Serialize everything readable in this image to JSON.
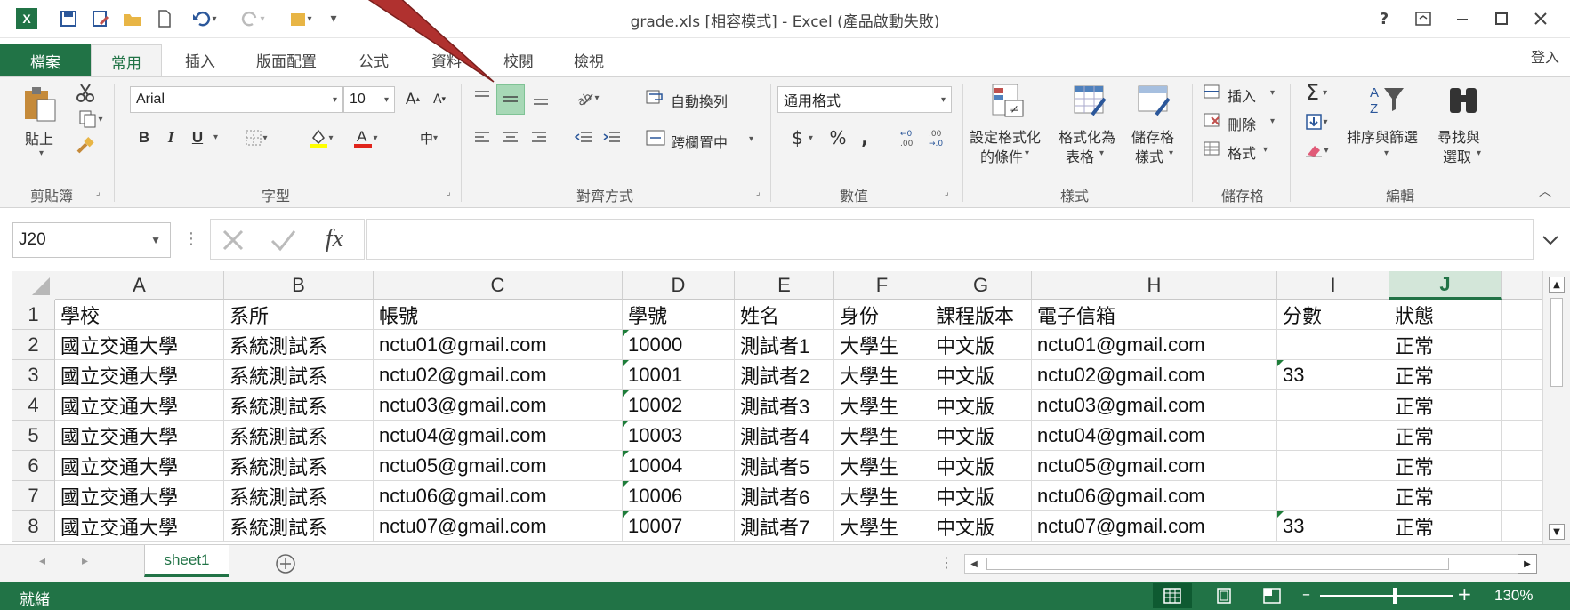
{
  "titlebar": {
    "title": "grade.xls  [相容模式] - Excel (產品啟動失敗)",
    "help": "?",
    "signin": "登入"
  },
  "tabs": {
    "file": "檔案",
    "home": "常用",
    "insert": "插入",
    "page_layout": "版面配置",
    "formulas": "公式",
    "data": "資料",
    "review": "校閱",
    "view": "檢視"
  },
  "ribbon": {
    "clipboard": {
      "paste": "貼上",
      "label": "剪貼簿"
    },
    "font": {
      "name": "Arial",
      "size": "10",
      "bold": "B",
      "italic": "I",
      "underline": "U",
      "label": "字型"
    },
    "alignment": {
      "wrap": "自動換列",
      "merge": "跨欄置中",
      "label": "對齊方式"
    },
    "number": {
      "format": "通用格式",
      "currency": "$",
      "percent": "%",
      "comma": ",",
      "label": "數值"
    },
    "styles": {
      "conditional": [
        "設定格式化",
        "的條件"
      ],
      "as_table": [
        "格式化為",
        "表格"
      ],
      "cell_styles": [
        "儲存格",
        "樣式"
      ],
      "label": "樣式"
    },
    "cells": {
      "insert": "插入",
      "delete": "刪除",
      "format": "格式",
      "label": "儲存格"
    },
    "editing": {
      "sort": "排序與篩選",
      "find": [
        "尋找與",
        "選取"
      ],
      "label": "編輯"
    }
  },
  "formula_bar": {
    "name_box": "J20",
    "fx": "fx",
    "value": ""
  },
  "grid": {
    "columns": [
      "A",
      "B",
      "C",
      "D",
      "E",
      "F",
      "G",
      "H",
      "I",
      "J"
    ],
    "rows": [
      "1",
      "2",
      "3",
      "4",
      "5",
      "6",
      "7",
      "8"
    ],
    "cells": [
      [
        "學校",
        "系所",
        "帳號",
        "學號",
        "姓名",
        "身份",
        "課程版本",
        "電子信箱",
        "分數",
        "狀態"
      ],
      [
        "國立交通大學",
        "系統測試系",
        "nctu01@gmail.com",
        "10000",
        "測試者1",
        "大學生",
        "中文版",
        "nctu01@gmail.com",
        "",
        "正常"
      ],
      [
        "國立交通大學",
        "系統測試系",
        "nctu02@gmail.com",
        "10001",
        "測試者2",
        "大學生",
        "中文版",
        "nctu02@gmail.com",
        "33",
        "正常"
      ],
      [
        "國立交通大學",
        "系統測試系",
        "nctu03@gmail.com",
        "10002",
        "測試者3",
        "大學生",
        "中文版",
        "nctu03@gmail.com",
        "",
        "正常"
      ],
      [
        "國立交通大學",
        "系統測試系",
        "nctu04@gmail.com",
        "10003",
        "測試者4",
        "大學生",
        "中文版",
        "nctu04@gmail.com",
        "",
        "正常"
      ],
      [
        "國立交通大學",
        "系統測試系",
        "nctu05@gmail.com",
        "10004",
        "測試者5",
        "大學生",
        "中文版",
        "nctu05@gmail.com",
        "",
        "正常"
      ],
      [
        "國立交通大學",
        "系統測試系",
        "nctu06@gmail.com",
        "10006",
        "測試者6",
        "大學生",
        "中文版",
        "nctu06@gmail.com",
        "",
        "正常"
      ],
      [
        "國立交通大學",
        "系統測試系",
        "nctu07@gmail.com",
        "10007",
        "測試者7",
        "大學生",
        "中文版",
        "nctu07@gmail.com",
        "33",
        "正常"
      ]
    ],
    "selected_column": "J"
  },
  "sheets": {
    "active": "sheet1"
  },
  "status": {
    "ready": "就緒",
    "zoom": "130%"
  },
  "colors": {
    "excel_green": "#217346",
    "annotation_arrow": "#b0312f"
  }
}
